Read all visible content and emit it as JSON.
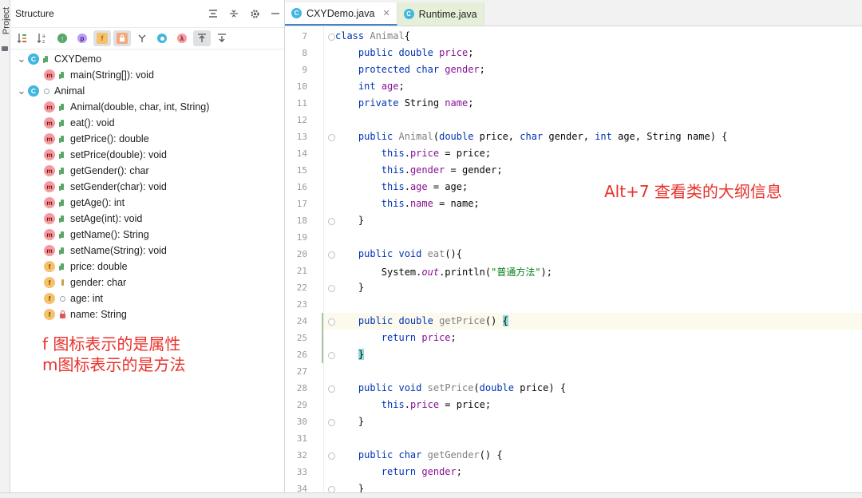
{
  "sidebar": {
    "project_label": "Project"
  },
  "structure": {
    "title": "Structure",
    "items": [
      {
        "indent": 0,
        "arrow": "v",
        "badge": "C",
        "kind": "class",
        "vis": "pub",
        "label": "CXYDemo"
      },
      {
        "indent": 1,
        "arrow": "",
        "badge": "m",
        "kind": "m",
        "vis": "pub",
        "label": "main(String[]): void"
      },
      {
        "indent": 0,
        "arrow": "v",
        "badge": "C",
        "kind": "class",
        "vis": "pkg",
        "label": "Animal"
      },
      {
        "indent": 1,
        "arrow": "",
        "badge": "m",
        "kind": "m",
        "vis": "pub",
        "label": "Animal(double, char, int, String)"
      },
      {
        "indent": 1,
        "arrow": "",
        "badge": "m",
        "kind": "m",
        "vis": "pub",
        "label": "eat(): void"
      },
      {
        "indent": 1,
        "arrow": "",
        "badge": "m",
        "kind": "m",
        "vis": "pub",
        "label": "getPrice(): double"
      },
      {
        "indent": 1,
        "arrow": "",
        "badge": "m",
        "kind": "m",
        "vis": "pub",
        "label": "setPrice(double): void"
      },
      {
        "indent": 1,
        "arrow": "",
        "badge": "m",
        "kind": "m",
        "vis": "pub",
        "label": "getGender(): char"
      },
      {
        "indent": 1,
        "arrow": "",
        "badge": "m",
        "kind": "m",
        "vis": "pub",
        "label": "setGender(char): void"
      },
      {
        "indent": 1,
        "arrow": "",
        "badge": "m",
        "kind": "m",
        "vis": "pub",
        "label": "getAge(): int"
      },
      {
        "indent": 1,
        "arrow": "",
        "badge": "m",
        "kind": "m",
        "vis": "pub",
        "label": "setAge(int): void"
      },
      {
        "indent": 1,
        "arrow": "",
        "badge": "m",
        "kind": "m",
        "vis": "pub",
        "label": "getName(): String"
      },
      {
        "indent": 1,
        "arrow": "",
        "badge": "m",
        "kind": "m",
        "vis": "pub",
        "label": "setName(String): void"
      },
      {
        "indent": 1,
        "arrow": "",
        "badge": "f",
        "kind": "f",
        "vis": "pub",
        "label": "price: double"
      },
      {
        "indent": 1,
        "arrow": "",
        "badge": "f",
        "kind": "f",
        "vis": "prot",
        "label": "gender: char"
      },
      {
        "indent": 1,
        "arrow": "",
        "badge": "f",
        "kind": "f",
        "vis": "pkg",
        "label": "age: int"
      },
      {
        "indent": 1,
        "arrow": "",
        "badge": "f",
        "kind": "f",
        "vis": "priv",
        "label": "name: String"
      }
    ],
    "annotation_line1": "f 图标表示的是属性",
    "annotation_line2": "m图标表示的是方法"
  },
  "tabs": [
    {
      "label": "CXYDemo.java",
      "active": true,
      "closable": true
    },
    {
      "label": "Runtime.java",
      "active": false,
      "closable": false
    }
  ],
  "editor": {
    "annotation": "Alt+7 查看类的大纲信息",
    "current_line": 24,
    "lines": [
      {
        "n": "7",
        "html": "<span class=\"kw\">class</span> <span class=\"unused\">Animal</span>{"
      },
      {
        "n": "8",
        "html": "    <span class=\"kw\">public double</span> <span class=\"fld\">price</span>;"
      },
      {
        "n": "9",
        "html": "    <span class=\"kw\">protected char</span> <span class=\"fld\">gender</span>;"
      },
      {
        "n": "10",
        "html": "    <span class=\"kw\">int</span> <span class=\"fld\">age</span>;"
      },
      {
        "n": "11",
        "html": "    <span class=\"kw\">private</span> String <span class=\"fld\">name</span>;"
      },
      {
        "n": "12",
        "html": ""
      },
      {
        "n": "13",
        "html": "    <span class=\"kw\">public</span> <span class=\"unused\">Animal</span>(<span class=\"kw\">double</span> price, <span class=\"kw\">char</span> gender, <span class=\"kw\">int</span> age, String name) {"
      },
      {
        "n": "14",
        "html": "        <span class=\"kw\">this</span>.<span class=\"fld\">price</span> = price;"
      },
      {
        "n": "15",
        "html": "        <span class=\"kw\">this</span>.<span class=\"fld\">gender</span> = gender;"
      },
      {
        "n": "16",
        "html": "        <span class=\"kw\">this</span>.<span class=\"fld\">age</span> = age;"
      },
      {
        "n": "17",
        "html": "        <span class=\"kw\">this</span>.<span class=\"fld\">name</span> = name;"
      },
      {
        "n": "18",
        "html": "    }"
      },
      {
        "n": "19",
        "html": ""
      },
      {
        "n": "20",
        "html": "    <span class=\"kw\">public void</span> <span class=\"unused\">eat</span>(){"
      },
      {
        "n": "21",
        "html": "        System.<span class=\"static\">out</span>.println(<span class=\"str\">\"普通方法\"</span>);"
      },
      {
        "n": "22",
        "html": "    }"
      },
      {
        "n": "23",
        "html": ""
      },
      {
        "n": "24",
        "html": "    <span class=\"kw\">public double</span> <span class=\"unused\">getPrice</span>() <span class=\"brace-hl\">{</span>"
      },
      {
        "n": "25",
        "html": "        <span class=\"kw\">return</span> <span class=\"fld\">price</span>;"
      },
      {
        "n": "26",
        "html": "    <span class=\"brace-hl\">}</span>"
      },
      {
        "n": "27",
        "html": ""
      },
      {
        "n": "28",
        "html": "    <span class=\"kw\">public void</span> <span class=\"unused\">setPrice</span>(<span class=\"kw\">double</span> price) {"
      },
      {
        "n": "29",
        "html": "        <span class=\"kw\">this</span>.<span class=\"fld\">price</span> = price;"
      },
      {
        "n": "30",
        "html": "    }"
      },
      {
        "n": "31",
        "html": ""
      },
      {
        "n": "32",
        "html": "    <span class=\"kw\">public char</span> <span class=\"unused\">getGender</span>() {"
      },
      {
        "n": "33",
        "html": "        <span class=\"kw\">return</span> <span class=\"fld\">gender</span>;"
      },
      {
        "n": "34",
        "html": "    }"
      }
    ]
  },
  "toolbar_icons": [
    "sort-by-visibility-icon",
    "sort-alphabetically-icon",
    "show-inherited-icon",
    "show-properties-icon",
    "show-fields-icon",
    "show-non-public-icon",
    "show-anonymous-icon",
    "show-lambdas-icon",
    "show-lambda-icon",
    "autoscroll-to-source-icon",
    "autoscroll-from-source-icon"
  ]
}
